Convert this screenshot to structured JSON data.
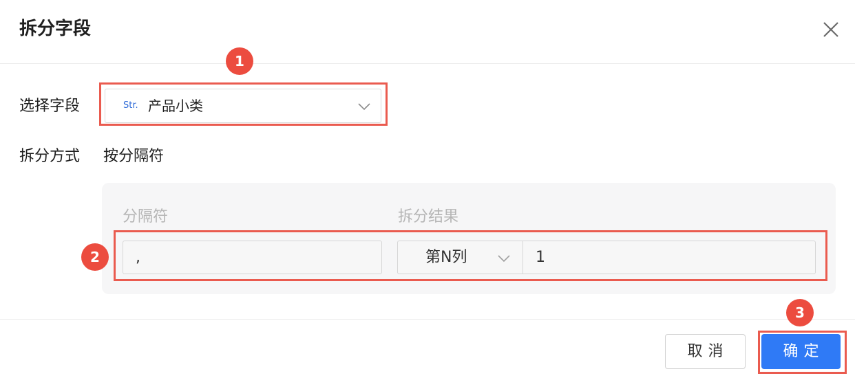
{
  "dialog": {
    "title": "拆分字段"
  },
  "form": {
    "field_label": "选择字段",
    "field_type_tag": "Str.",
    "field_value": "产品小类",
    "method_label": "拆分方式",
    "method_value": "按分隔符"
  },
  "split_panel": {
    "separator_header": "分隔符",
    "result_header": "拆分结果",
    "separator_value": ",",
    "result_mode": "第N列",
    "result_index": "1"
  },
  "footer": {
    "cancel_label": "取消",
    "ok_label": "确定"
  },
  "annotations": {
    "step1": "1",
    "step2": "2",
    "step3": "3"
  },
  "colors": {
    "accent": "#2f7af6",
    "annotation_red": "#ec4c3f",
    "type_tag_blue": "#2f6bd8"
  }
}
